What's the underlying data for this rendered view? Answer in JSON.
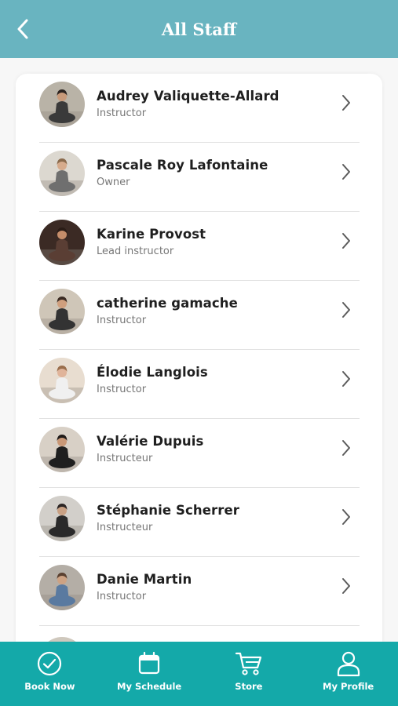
{
  "header": {
    "title": "All Staff"
  },
  "staff": [
    {
      "name": "Audrey Valiquette-Allard",
      "role": "Instructor",
      "bg": "#b9b3a7",
      "skin": "#c89a7a",
      "hair": "#2b2320",
      "cloth": "#3a3a3a"
    },
    {
      "name": "Pascale Roy Lafontaine",
      "role": "Owner",
      "bg": "#dcd8d0",
      "skin": "#d6ab8c",
      "hair": "#8a6a4c",
      "cloth": "#6f6f6f"
    },
    {
      "name": "Karine Provost",
      "role": "Lead instructor",
      "bg": "#3b2a24",
      "skin": "#c58d6a",
      "hair": "#2a1c16",
      "cloth": "#5a3e34"
    },
    {
      "name": "catherine gamache",
      "role": "Instructor",
      "bg": "#cfc6b8",
      "skin": "#cf9f7e",
      "hair": "#3a2a22",
      "cloth": "#333333"
    },
    {
      "name": "Élodie Langlois",
      "role": "Instructor",
      "bg": "#e8ddd0",
      "skin": "#e0b49a",
      "hair": "#9a6e4c",
      "cloth": "#f0f0f0"
    },
    {
      "name": "Valérie Dupuis",
      "role": "Instructeur",
      "bg": "#d8d0c6",
      "skin": "#c99877",
      "hair": "#1f1a18",
      "cloth": "#1f1f1f"
    },
    {
      "name": "Stéphanie Scherrer",
      "role": "Instructeur",
      "bg": "#d2cfca",
      "skin": "#c9a184",
      "hair": "#2b2524",
      "cloth": "#2a2a2a"
    },
    {
      "name": "Danie Martin",
      "role": "Instructor",
      "bg": "#b4aea6",
      "skin": "#cda283",
      "hair": "#5a4030",
      "cloth": "#5a7aa0"
    }
  ],
  "tabs": [
    {
      "label": "Book Now",
      "icon": "check-circle-icon"
    },
    {
      "label": "My Schedule",
      "icon": "calendar-icon"
    },
    {
      "label": "Store",
      "icon": "cart-icon"
    },
    {
      "label": "My Profile",
      "icon": "person-icon"
    }
  ],
  "colors": {
    "header": "#69b4c0",
    "tabbar": "#14a9a9"
  }
}
